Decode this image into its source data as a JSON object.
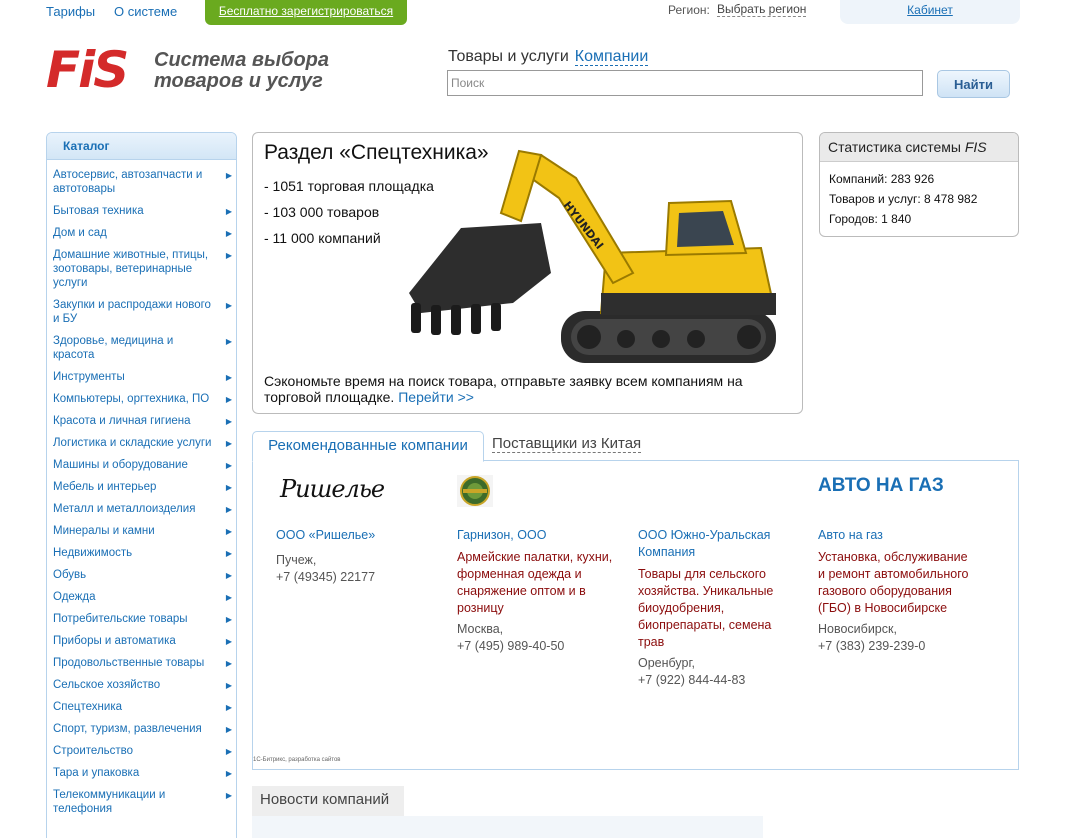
{
  "topbar": {
    "tariffs": "Тарифы",
    "about": "О системе",
    "register": "Бесплатно зарегистрироваться",
    "region_label": "Регион:",
    "region_link": "Выбрать регион",
    "cabinet": "Кабинет"
  },
  "logo": {
    "mark": "FiS",
    "line1": "Система выбора",
    "line2": "товаров и услуг"
  },
  "search": {
    "tab_goods": "Товары и услуги",
    "tab_companies": "Компании",
    "placeholder": "Поиск",
    "button": "Найти"
  },
  "catalog": {
    "title": "Каталог",
    "items": [
      "Автосервис, автозапчасти и автотовары",
      "Бытовая техника",
      "Дом и сад",
      "Домашние животные, птицы, зоотовары, ветеринарные услуги",
      "Закупки и распродажи нового и БУ",
      "Здоровье, медицина и красота",
      "Инструменты",
      "Компьютеры, оргтехника, ПО",
      "Красота и личная гигиена",
      "Логистика и складские услуги",
      "Машины и оборудование",
      "Мебель и интерьер",
      "Металл и металлоизделия",
      "Минералы и камни",
      "Недвижимость",
      "Обувь",
      "Одежда",
      "Потребительские товары",
      "Приборы и автоматика",
      "Продовольственные товары",
      "Сельское хозяйство",
      "Спецтехника",
      "Спорт, туризм, развлечения",
      "Строительство",
      "Тара и упаковка",
      "Телекоммуникации и телефония"
    ]
  },
  "promo": {
    "title": "Раздел «Спецтехника»",
    "bullets": [
      "- 1051 торговая площадка",
      "- 103 000 товаров",
      "- 11 000 компаний"
    ],
    "text": "Сэкономьте время на поиск товара, отправьте заявку всем компаниям на торговой площадке.",
    "link": "Перейти >>",
    "image_brand": "HYUNDAI"
  },
  "stats": {
    "title_prefix": "Статистика системы",
    "title_brand": "FIS",
    "companies": "Компаний: 283 926",
    "goods": "Товаров и услуг: 8 478 982",
    "cities": "Городов: 1 840"
  },
  "tabs": {
    "recommended": "Рекомендованные компании",
    "china": "Поставщики из Китая"
  },
  "companies": [
    {
      "logo_text": "Ришелье",
      "name": "ООО «Ришелье»",
      "desc": "",
      "city": "Пучеж,",
      "phone": "+7 (49345) 22177"
    },
    {
      "logo_text": "",
      "name": "Гарнизон, ООО",
      "desc": "Армейские палатки, кухни, форменная одежда и снаряжение оптом и в розницу",
      "city": "Москва,",
      "phone": "+7 (495) 989-40-50"
    },
    {
      "logo_text": "",
      "name": "ООО Южно-Уральская Компания",
      "desc": "Товары для сельского хозяйства. Уникальные биоудобрения, биопрепараты, семена трав",
      "city": "Оренбург,",
      "phone": "+7 (922) 844-44-83"
    },
    {
      "logo_text": "АВТО НА ГАЗ",
      "name": "Авто на газ",
      "desc": "Установка, обслуживание и ремонт автомобильного газового оборудования (ГБО) в Новосибирске",
      "city": "Новосибирск,",
      "phone": "+7 (383) 239-239-0"
    }
  ],
  "footer_credit": "1С-Битрикс, разработка сайтов",
  "news": {
    "title": "Новости компаний"
  },
  "colors": {
    "link": "#1a6fb5",
    "register_green": "#6aaa1f",
    "logo_red": "#d42a2a",
    "desc_red": "#8b0d0d",
    "excavator_yellow": "#f2c315"
  }
}
